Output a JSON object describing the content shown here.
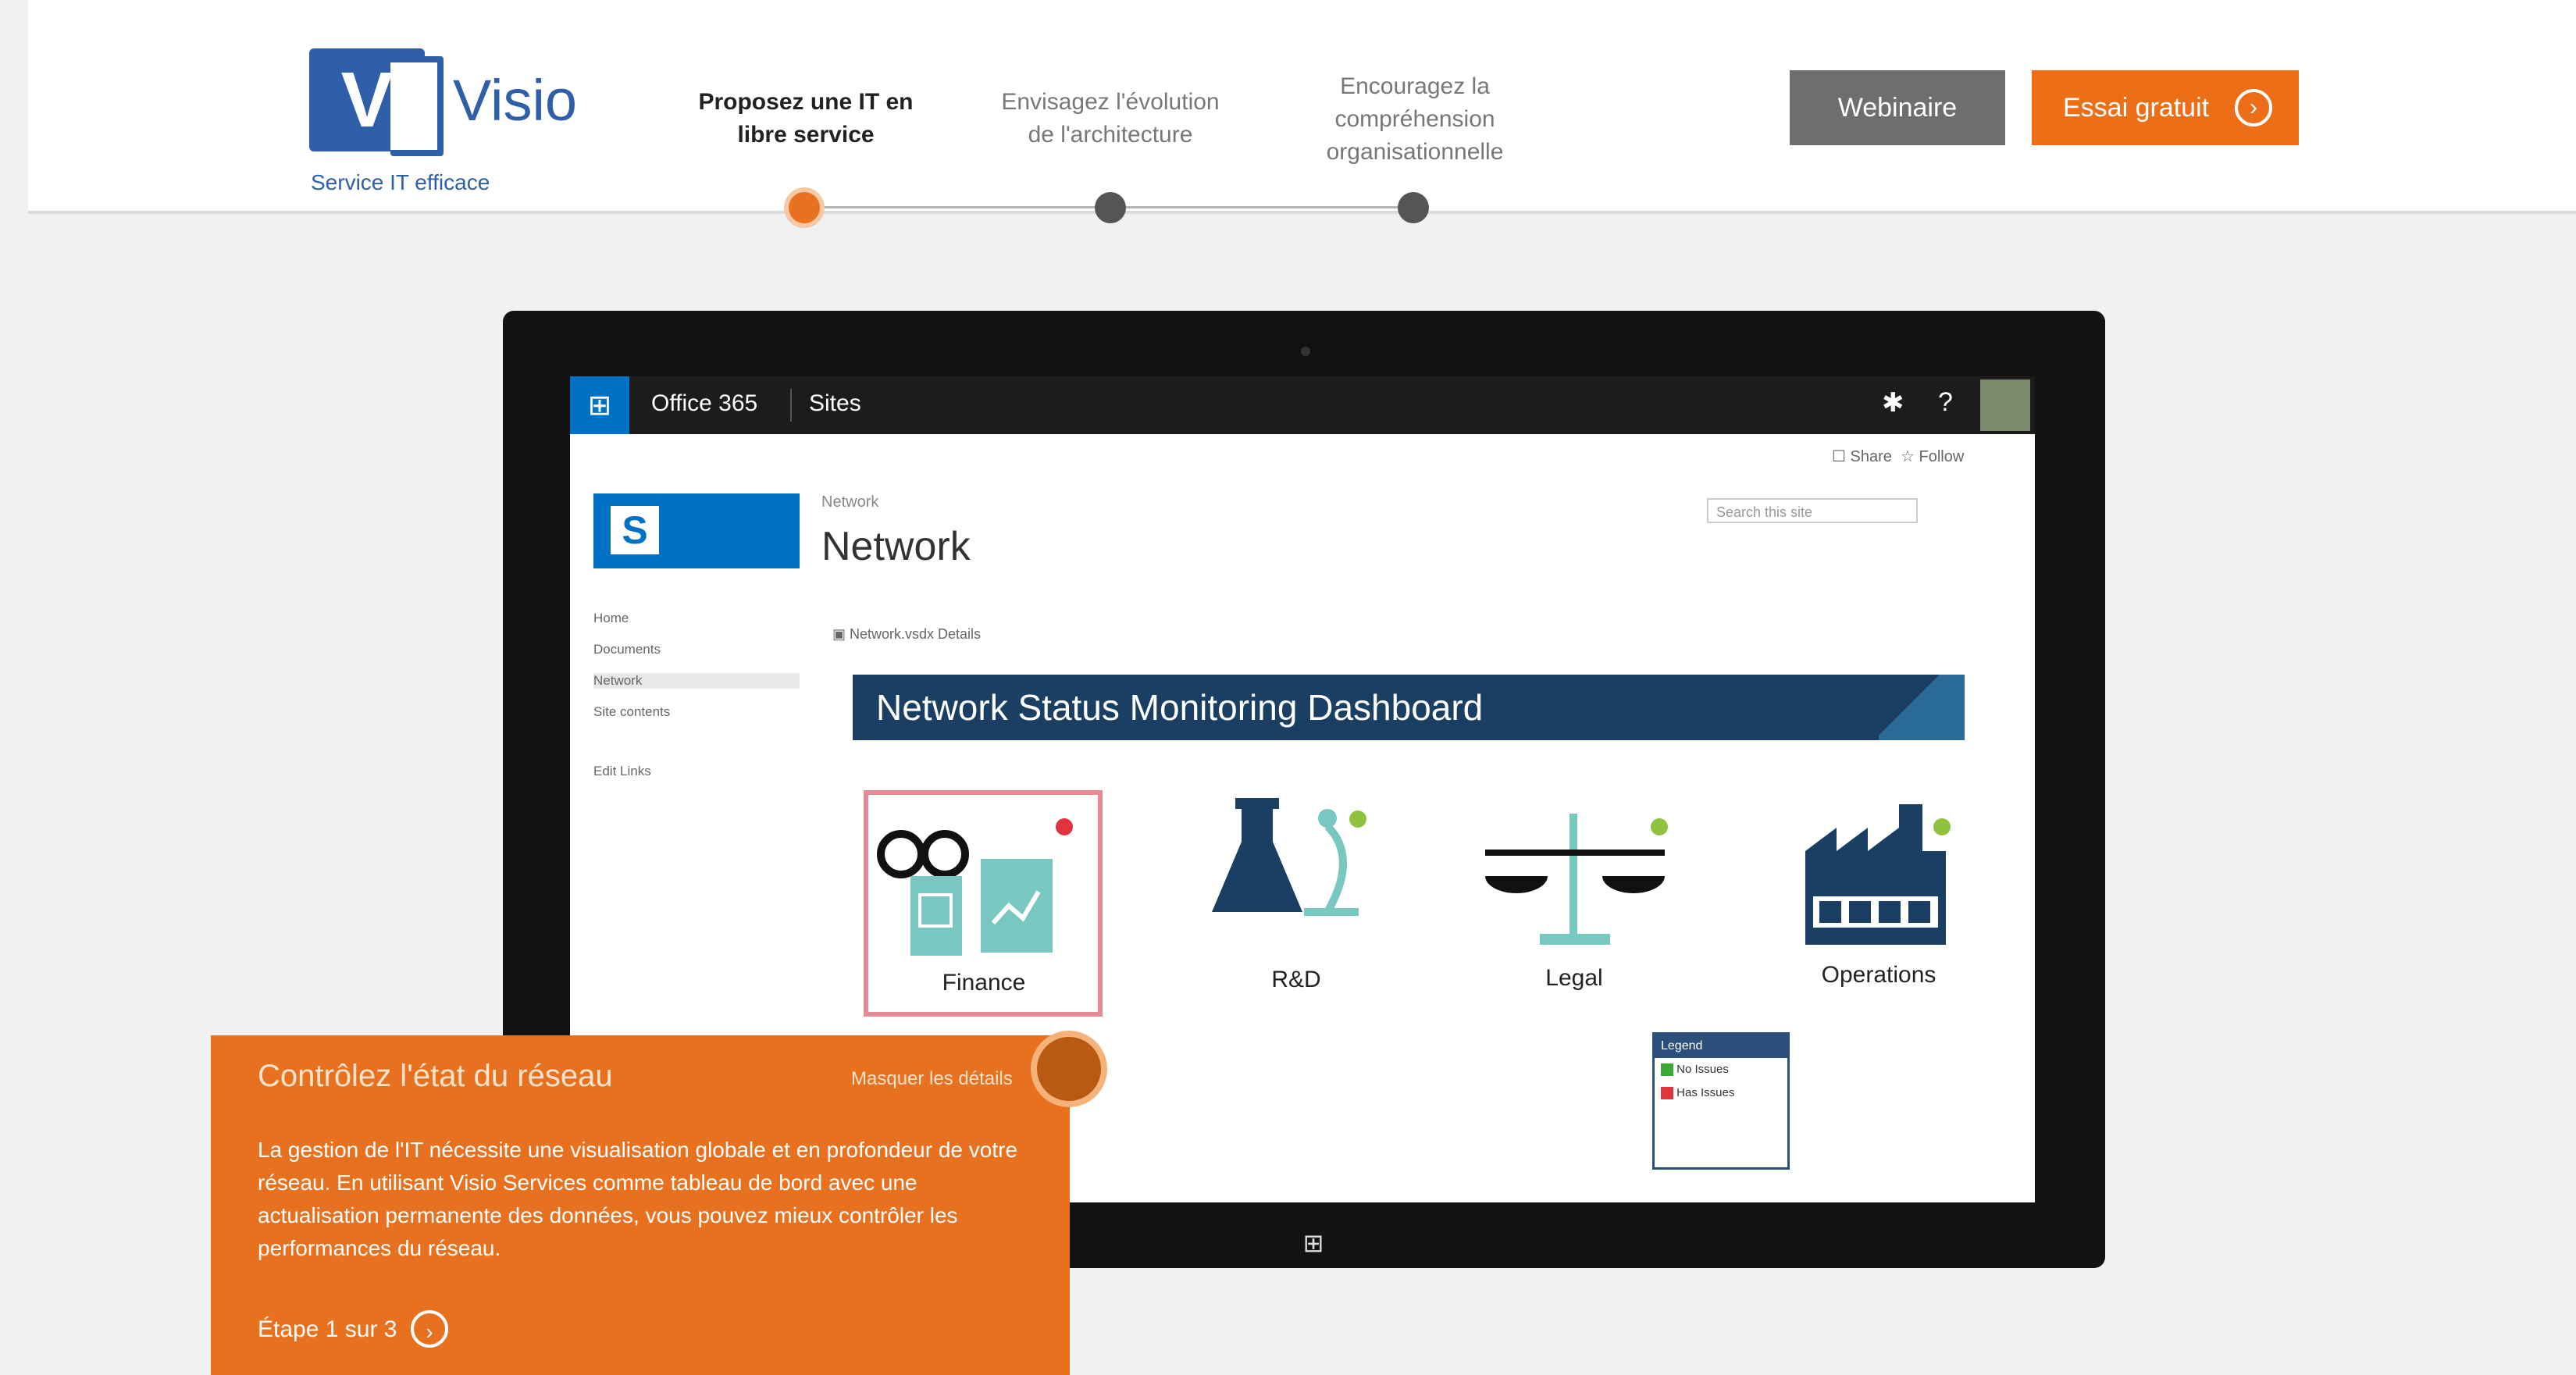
{
  "header": {
    "logo_mark": "V",
    "app_name": "Visio",
    "tagline": "Service IT efficace",
    "steps": [
      {
        "label": "Proposez une IT en libre service"
      },
      {
        "label": "Envisagez l'évolution de l'architecture"
      },
      {
        "label": "Encouragez la compréhension organisationnelle"
      }
    ],
    "webinar_label": "Webinaire",
    "try_label": "Essai gratuit",
    "try_icon": "arrow-circle-icon"
  },
  "tablet": {
    "topbar": {
      "waffle_glyph": "⊞",
      "office_label": "Office 365",
      "sites_label": "Sites",
      "gear_glyph": "✱",
      "help_glyph": "?"
    },
    "actions": {
      "share": "☐ Share",
      "follow": "☆ Follow"
    },
    "site_logo_letter": "S",
    "breadcrumb": "Network",
    "page_title": "Network",
    "search_placeholder": "Search this site",
    "nav": [
      "Home",
      "Documents",
      "Network",
      "Site contents",
      "Edit Links"
    ],
    "doc_toolbar": "▣ Network.vsdx     Details",
    "dashboard_title": "Network Status Monitoring Dashboard",
    "tiles": [
      {
        "label": "Finance",
        "status_color": "#e0343f"
      },
      {
        "label": "R&D",
        "status_color": "#8fc23f"
      },
      {
        "label": "Legal",
        "status_color": "#8fc23f"
      },
      {
        "label": "Operations",
        "status_color": "#8fc23f"
      }
    ],
    "legend": {
      "title": "Legend",
      "items": [
        {
          "label": "No Issues",
          "color": "#3aaa35"
        },
        {
          "label": "Has Issues",
          "color": "#e0343f"
        }
      ]
    },
    "home_glyph": "⊞"
  },
  "callout": {
    "title": "Contrôlez l'état du réseau",
    "link": "Masquer les détails",
    "body": "La gestion de l'IT nécessite une visualisation globale et en profondeur de votre réseau. En utilisant Visio Services comme tableau de bord avec une actualisation permanente des données, vous pouvez mieux contrôler les performances du réseau.",
    "step_text": "Étape 1 sur 3",
    "step_glyph": "›"
  },
  "colors": {
    "accent": "#e8711f",
    "brand": "#2e5fa8",
    "dashboard": "#1b3f63"
  }
}
